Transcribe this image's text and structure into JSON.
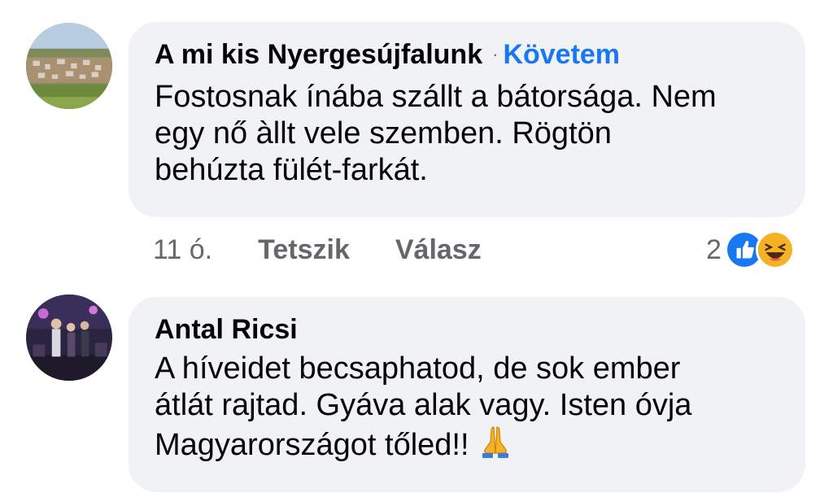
{
  "comments": [
    {
      "author": "A mi kis Nyergesújfalunk",
      "separator": "·",
      "follow_label": "Követem",
      "lines": [
        "Fostosnak ínába szállt a bátorsága. Nem",
        "egy nő àllt vele szemben. Rögtön",
        "behúzta fülét-farkát."
      ],
      "time": "11 ó.",
      "like_label": "Tetszik",
      "reply_label": "Válasz",
      "reaction_count": "2",
      "reactions": [
        "like-icon",
        "haha-icon"
      ]
    },
    {
      "author": "Antal Ricsi",
      "lines": [
        "A híveidet becsaphatod, de sok ember",
        "átlát rajtad. Gyáva alak vagy. Isten óvja",
        "Magyarországot tőled!!"
      ],
      "emoji": "folded-hands-icon"
    }
  ],
  "colors": {
    "bubble": "#f0f2f5",
    "link": "#1877f2",
    "secondary": "#65676b",
    "text": "#050505",
    "like": "#1877f2",
    "haha": "#f7b125"
  }
}
